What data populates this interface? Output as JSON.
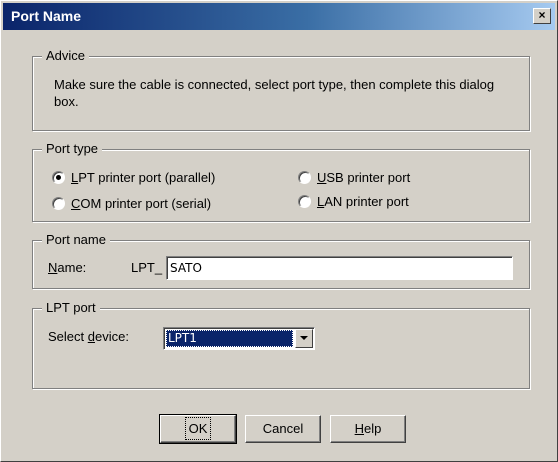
{
  "window": {
    "title": "Port Name",
    "close_label": "×"
  },
  "advice": {
    "legend": "Advice",
    "text": "Make sure the cable is connected, select port type, then complete this dialog box."
  },
  "port_type": {
    "legend": "Port type",
    "options": [
      {
        "prefix": "",
        "accel": "L",
        "rest": "PT printer port (parallel)",
        "checked": true
      },
      {
        "prefix": "",
        "accel": "U",
        "rest": "SB printer port",
        "checked": false
      },
      {
        "prefix": "",
        "accel": "C",
        "rest": "OM printer port (serial)",
        "checked": false
      },
      {
        "prefix": "",
        "accel": "L",
        "rest": "AN printer port",
        "checked": false
      }
    ]
  },
  "port_name": {
    "legend": "Port name",
    "label_accel": "N",
    "label_rest": "ame:",
    "prefix": "LPT_",
    "value": "SATO"
  },
  "lpt_port": {
    "legend": "LPT port",
    "label_before": "Select ",
    "label_accel": "d",
    "label_after": "evice:",
    "selected": "LPT1"
  },
  "buttons": {
    "ok": "OK",
    "cancel": "Cancel",
    "help_accel": "H",
    "help_rest": "elp"
  }
}
